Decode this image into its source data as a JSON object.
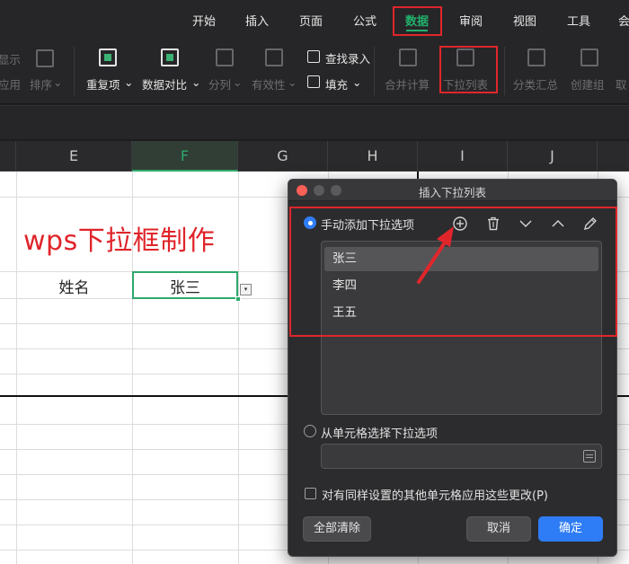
{
  "menubar": {
    "items": [
      "开始",
      "插入",
      "页面",
      "公式",
      "数据",
      "审阅",
      "视图",
      "工具",
      "会"
    ],
    "active_index": 4
  },
  "ribbon": {
    "items": [
      "显示",
      "应用",
      "排序",
      "重复项",
      "数据对比",
      "分列",
      "有效性",
      "查找录入",
      "填充",
      "合并计算",
      "下拉列表",
      "分类汇总",
      "创建组",
      "取"
    ]
  },
  "columns": [
    "E",
    "F",
    "G",
    "H",
    "I",
    "J"
  ],
  "sheet": {
    "title": "wps下拉框制作",
    "name_label": "姓名",
    "name_value": "张三",
    "dropdown_glyph": "▾"
  },
  "dialog": {
    "title": "插入下拉列表",
    "option_manual": "手动添加下拉选项",
    "list_items": [
      "张三",
      "李四",
      "王五"
    ],
    "selected_index": 0,
    "option_cells": "从单元格选择下拉选项",
    "checkbox_label": "对有同样设置的其他单元格应用这些更改(P)",
    "clear_all": "全部清除",
    "cancel": "取消",
    "confirm": "确定"
  },
  "colors": {
    "accent_green": "#21b06b",
    "highlight_red": "#e0262b",
    "primary_blue": "#2f7df6"
  },
  "icons": [
    "plus-circle-icon",
    "trash-icon",
    "chevron-down-icon",
    "chevron-up-icon",
    "pencil-icon",
    "select-range-icon"
  ]
}
